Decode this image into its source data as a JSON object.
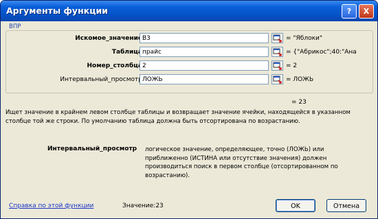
{
  "window": {
    "title": "Аргументы функции"
  },
  "function_name": "ВПР",
  "arguments": [
    {
      "label": "Искомое_значение",
      "value": "B3",
      "result": "= \"Яблоки\""
    },
    {
      "label": "Таблица",
      "value": "прайс",
      "result": "= {\"Абрикос\";40:\"Ана"
    },
    {
      "label": "Номер_столбца",
      "value": "2",
      "result": "= 2"
    },
    {
      "label": "Интервальный_просмотр",
      "value": "ЛОЖЬ",
      "result": "= ЛОЖЬ"
    }
  ],
  "formula_result": "= 23",
  "description": "Ищет значение в крайнем левом столбце таблицы и возвращает значение ячейки, находящейся в указанном столбце той же строки. По умолчанию таблица должна быть отсортирована по возрастанию.",
  "argument_help": {
    "name": "Интервальный_просмотр",
    "text": "логическое значение, определяющее, точно (ЛОЖЬ) или приближенно (ИСТИНА или отсутствие значения) должен производиться поиск в первом столбце (отсортированном по возрастанию)."
  },
  "footer": {
    "help_link": "Справка по этой функции",
    "value_label": "Значение:",
    "value": "23",
    "ok_label": "OK",
    "cancel_label": "Отмена"
  },
  "titlebar_buttons": {
    "help": "?",
    "close": "X"
  }
}
